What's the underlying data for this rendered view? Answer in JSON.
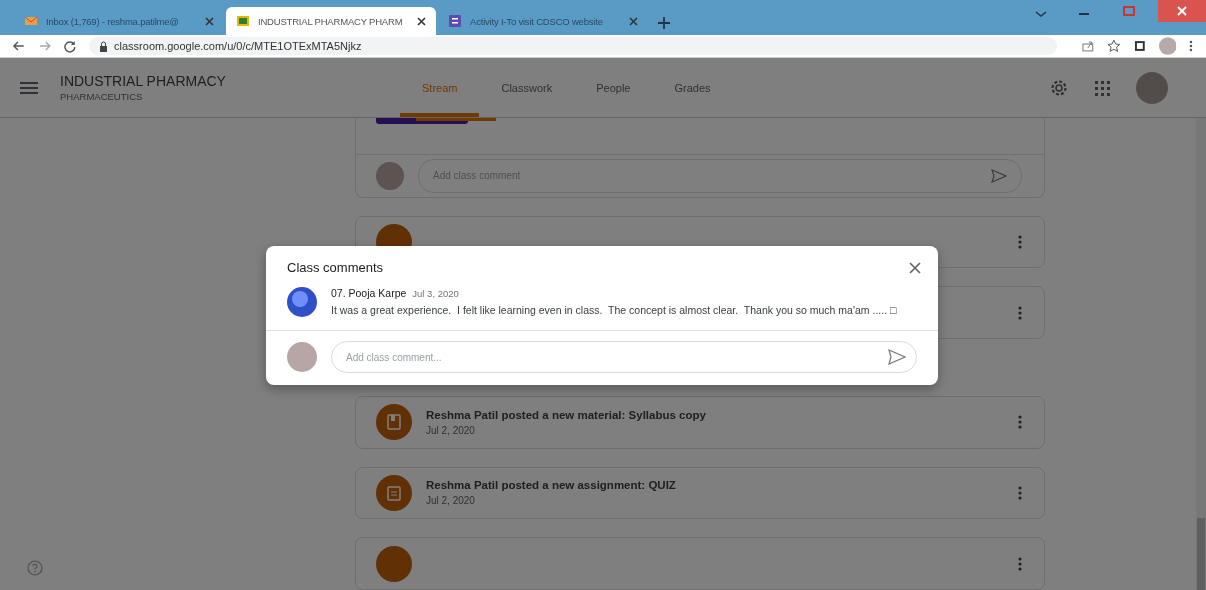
{
  "browser": {
    "tabs": [
      {
        "title": "Inbox (1,769) - reshma.patilme@",
        "kind": "mail",
        "selected": false
      },
      {
        "title": "INDUSTRIAL PHARMACY PHARM",
        "kind": "classroom",
        "selected": true
      },
      {
        "title": "Activity I-To visit CDSCO website",
        "kind": "form",
        "selected": false
      }
    ],
    "url": "classroom.google.com/u/0/c/MTE1OTExMTA5Njkz"
  },
  "header": {
    "class_name": "INDUSTRIAL PHARMACY",
    "section": "PHARMACEUTICS",
    "tabs": [
      {
        "label": "Stream",
        "selected": true
      },
      {
        "label": "Classwork",
        "selected": false
      },
      {
        "label": "People",
        "selected": false
      },
      {
        "label": "Grades",
        "selected": false
      }
    ]
  },
  "stream": {
    "comment_placeholder": "Add class comment",
    "posts": [
      {
        "kind": "material",
        "title": "Reshma Patil posted a new material: Syllabus copy",
        "date": "Jul 2, 2020"
      },
      {
        "kind": "assignment",
        "title": "Reshma Patil posted a new assignment: QUIZ",
        "date": "Jul 2, 2020"
      }
    ]
  },
  "dialog": {
    "title": "Class comments",
    "comments": [
      {
        "author": "07. Pooja Karpe",
        "date": "Jul 3, 2020",
        "text": "It was a great experience.  I felt like learning even in class.  The concept is almost clear.  Thank you so much ma'am ..... □"
      }
    ],
    "placeholder": "Add class comment..."
  }
}
